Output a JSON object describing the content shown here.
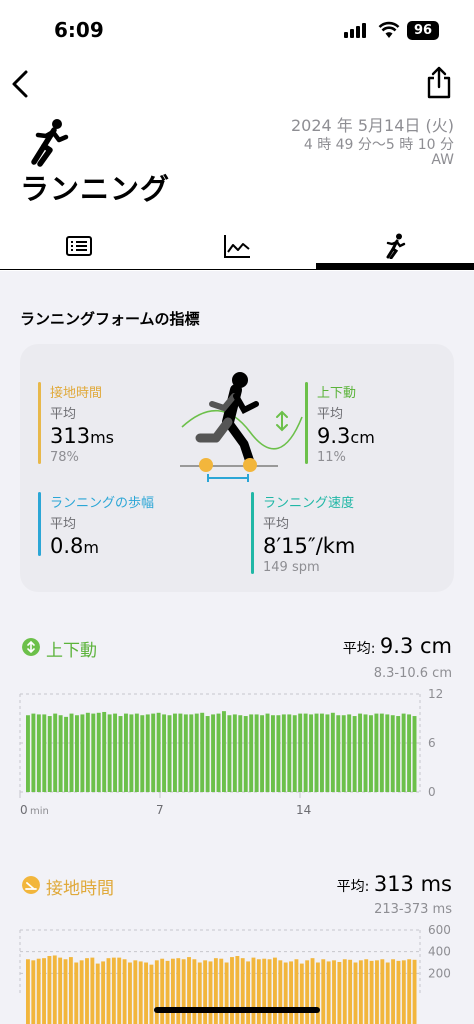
{
  "status": {
    "time": "6:09",
    "battery": "96"
  },
  "header": {
    "title": "ランニング",
    "date": "2024 年 5月14日 (火)",
    "time_range": "4 時 49 分〜5 時 10 分",
    "source": "AW"
  },
  "tabs": [
    {
      "name": "details",
      "icon": "list-icon",
      "selected": false
    },
    {
      "name": "graphs",
      "icon": "chart-icon",
      "selected": false
    },
    {
      "name": "form",
      "icon": "runner-icon",
      "selected": true
    }
  ],
  "form": {
    "section_title": "ランニングフォームの指標",
    "ground_contact": {
      "title": "接地時間",
      "sub": "平均",
      "value": "313",
      "unit": "ms",
      "pct": "78%",
      "color": "#e8b84a"
    },
    "vertical_osc": {
      "title": "上下動",
      "sub": "平均",
      "value": "9.3",
      "unit": "cm",
      "pct": "11%",
      "color": "#6cc04a"
    },
    "stride": {
      "title": "ランニングの歩幅",
      "sub": "平均",
      "value": "0.8",
      "unit": "m",
      "color": "#2ba6d6"
    },
    "speed": {
      "title": "ランニング速度",
      "sub": "平均",
      "value": "8′15″/km",
      "cadence": "149 spm",
      "color": "#20b7a6"
    }
  },
  "chart_vertical": {
    "title": "上下動",
    "avg_label": "平均: ",
    "avg_value": "9.3",
    "avg_unit": " cm",
    "range": "8.3-10.6 cm",
    "color": "#6cc04a"
  },
  "chart_contact": {
    "title": "接地時間",
    "avg_label": "平均: ",
    "avg_value": "313",
    "avg_unit": " ms",
    "range": "213-373 ms",
    "color": "#f2b63c"
  },
  "chart_data": [
    {
      "type": "bar",
      "title": "上下動",
      "ylim": [
        0,
        12
      ],
      "yticks": [
        "12",
        "6",
        "0"
      ],
      "xticks": [
        "0",
        "7",
        "14"
      ],
      "x_unit": "min",
      "values": [
        9.4,
        9.6,
        9.5,
        9.5,
        9.3,
        9.6,
        9.4,
        9.2,
        9.6,
        9.4,
        9.5,
        9.7,
        9.6,
        9.7,
        9.8,
        9.5,
        9.6,
        9.3,
        9.6,
        9.5,
        9.6,
        9.4,
        9.5,
        9.6,
        9.7,
        9.5,
        9.4,
        9.6,
        9.6,
        9.5,
        9.5,
        9.6,
        9.7,
        9.3,
        9.5,
        9.6,
        9.9,
        9.4,
        9.5,
        9.4,
        9.3,
        9.5,
        9.5,
        9.4,
        9.6,
        9.4,
        9.4,
        9.5,
        9.5,
        9.4,
        9.6,
        9.6,
        9.5,
        9.6,
        9.6,
        9.5,
        9.7,
        9.4,
        9.4,
        9.5,
        9.3,
        9.6,
        9.5,
        9.4,
        9.6,
        9.6,
        9.5,
        9.4,
        9.3,
        9.6,
        9.5,
        9.3
      ]
    },
    {
      "type": "bar",
      "title": "接地時間",
      "ylim": [
        0,
        600
      ],
      "yticks": [
        "600",
        "400",
        "200"
      ],
      "values": [
        330,
        320,
        335,
        340,
        360,
        365,
        345,
        330,
        350,
        300,
        320,
        340,
        345,
        290,
        310,
        340,
        345,
        345,
        330,
        300,
        320,
        310,
        300,
        280,
        320,
        335,
        315,
        335,
        340,
        330,
        350,
        330,
        300,
        320,
        310,
        340,
        335,
        300,
        350,
        360,
        340,
        310,
        345,
        330,
        335,
        330,
        345,
        320,
        300,
        310,
        330,
        290,
        320,
        340,
        300,
        330,
        310,
        320,
        305,
        330,
        325,
        300,
        320,
        330,
        315,
        320,
        330,
        300,
        330,
        315,
        320,
        330,
        325
      ]
    }
  ]
}
